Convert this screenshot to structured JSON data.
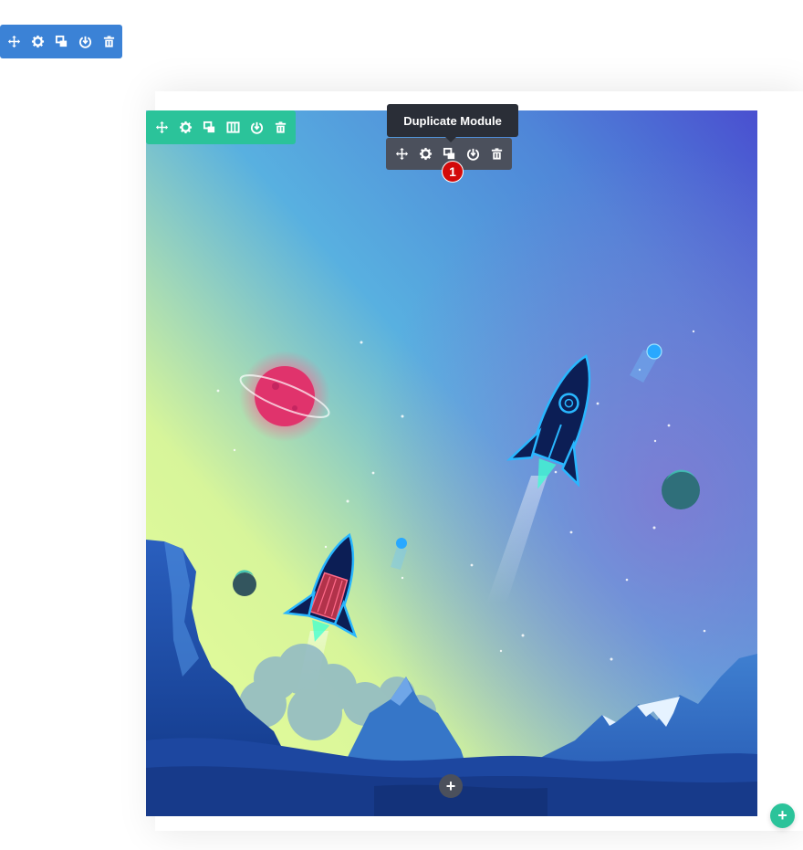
{
  "section_toolbar": {
    "color": "#3b82d6",
    "icons": [
      "move-icon",
      "settings-icon",
      "duplicate-icon",
      "save-icon",
      "delete-icon"
    ]
  },
  "row_toolbar": {
    "color": "#2bc39a",
    "icons": [
      "move-icon",
      "settings-icon",
      "duplicate-icon",
      "columns-icon",
      "save-icon",
      "delete-icon"
    ]
  },
  "module_toolbar": {
    "color": "#4b505c",
    "icons": [
      "move-icon",
      "settings-icon",
      "duplicate-icon",
      "save-icon",
      "delete-icon"
    ],
    "tooltip": "Duplicate Module",
    "step_badge": "1",
    "badge_color": "#d30a0a"
  },
  "illustration": {
    "subject": "space-scene-rockets",
    "gradient_colors": [
      "#e9ff9a",
      "#56b0e0",
      "#4a57d0"
    ],
    "planet_color": "#e0336c",
    "mountain_color": "#1f4fa8"
  },
  "add_module_button": {
    "label": "+",
    "color": "#4b505c"
  },
  "add_row_button": {
    "label": "+",
    "color": "#2bc39a"
  }
}
